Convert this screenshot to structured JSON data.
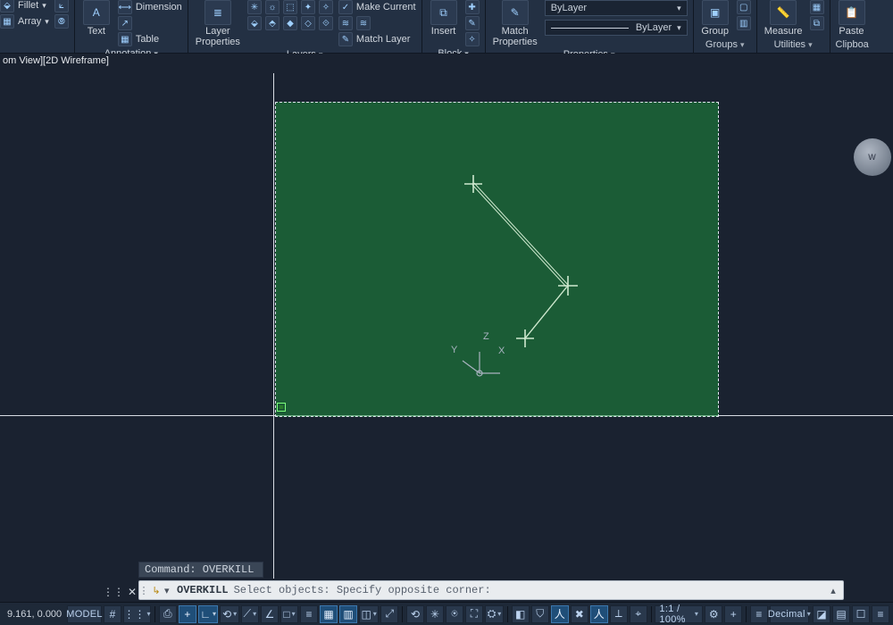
{
  "ribbon": {
    "fillet_label": "Fillet",
    "array_label": "Array",
    "text_label": "Text",
    "dimension_label": "Dimension",
    "table_label": "Table",
    "annotation_title": "Annotation",
    "layer_props_label": "Layer\nProperties",
    "make_current_label": "Make Current",
    "match_layer_label": "Match Layer",
    "layers_title": "Layers",
    "insert_label": "Insert",
    "block_title": "Block",
    "match_props_label": "Match\nProperties",
    "bylayer1": "ByLayer",
    "bylayer2": "ByLayer",
    "properties_title": "Properties",
    "group_label": "Group",
    "groups_title": "Groups",
    "measure_label": "Measure",
    "utilities_title": "Utilities",
    "paste_label": "Paste",
    "clipboard_title": "Clipboa"
  },
  "view": {
    "label": "om View][2D Wireframe]",
    "viewcube": "W"
  },
  "ucs": {
    "x": "X",
    "y": "Y",
    "z": "Z"
  },
  "cmd": {
    "history": "Command: OVERKILL",
    "active": "OVERKILL",
    "prompt": "Select objects: Specify opposite corner:"
  },
  "status": {
    "coords": "9.161, 0.000",
    "model": "MODEL",
    "scale": "1:1 / 100%",
    "units": "Decimal",
    "grid": "#",
    "snap": "⋮⋮",
    "infer": "⎙",
    "dyn": "+",
    "ortho": "∟",
    "polar": "⟲",
    "iso": "⟋",
    "track": "∠",
    "osnap": "□",
    "os3d": "◫",
    "lwt": "≡",
    "trn": "▦",
    "sc": "▥",
    "qp": "⤢",
    "ann": "⟲",
    "amon": "✳",
    "avis": "⍟",
    "xr": "⛶",
    "ws": "⛭",
    "p1": "◧",
    "p2": "⛉",
    "p3": "人",
    "p4": "✖",
    "p5": "人",
    "p6": "⟂",
    "p7": "⌖",
    "p8": "≡",
    "zoom_plus": "+",
    "gear": "⚙",
    "d1": "◪",
    "d2": "▤",
    "d3": "☐",
    "d4": "≡"
  }
}
